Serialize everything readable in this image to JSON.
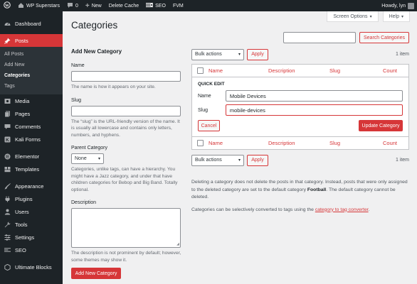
{
  "admin_bar": {
    "site_name": "WP Superstars",
    "comments_count": "0",
    "new_label": "New",
    "delete_cache_label": "Delete Cache",
    "seo_label": "SEO",
    "fvm_label": "FVM",
    "howdy": "Howdy, lyn"
  },
  "sidebar": {
    "items": [
      {
        "label": "Dashboard",
        "icon": "dashboard-icon"
      },
      {
        "label": "Posts",
        "icon": "pin-icon"
      },
      {
        "label": "Media",
        "icon": "media-icon"
      },
      {
        "label": "Pages",
        "icon": "pages-icon"
      },
      {
        "label": "Comments",
        "icon": "comments-icon"
      },
      {
        "label": "Kali Forms",
        "icon": "kali-forms-icon"
      },
      {
        "label": "Elementor",
        "icon": "elementor-icon"
      },
      {
        "label": "Templates",
        "icon": "templates-icon"
      },
      {
        "label": "Appearance",
        "icon": "brush-icon"
      },
      {
        "label": "Plugins",
        "icon": "plugins-icon"
      },
      {
        "label": "Users",
        "icon": "users-icon"
      },
      {
        "label": "Tools",
        "icon": "tools-icon"
      },
      {
        "label": "Settings",
        "icon": "settings-icon"
      },
      {
        "label": "SEO",
        "icon": "seo-icon"
      },
      {
        "label": "Ultimate Blocks",
        "icon": "ultimate-blocks-icon"
      }
    ],
    "posts_submenu": [
      "All Posts",
      "Add New",
      "Categories",
      "Tags"
    ]
  },
  "header": {
    "screen_options": "Screen Options",
    "help": "Help",
    "title": "Categories",
    "search_button": "Search Categories"
  },
  "add_form": {
    "heading": "Add New Category",
    "name_label": "Name",
    "name_desc": "The name is how it appears on your site.",
    "slug_label": "Slug",
    "slug_desc": "The “slug” is the URL-friendly version of the name. It is usually all lowercase and contains only letters, numbers, and hyphens.",
    "parent_label": "Parent Category",
    "parent_value": "None",
    "parent_desc": "Categories, unlike tags, can have a hierarchy. You might have a Jazz category, and under that have children categories for Bebop and Big Band. Totally optional.",
    "description_label": "Description",
    "description_desc": "The description is not prominent by default; however, some themes may show it.",
    "submit": "Add New Category"
  },
  "list": {
    "bulk_actions": "Bulk actions",
    "apply": "Apply",
    "item_count": "1 item",
    "columns": {
      "name": "Name",
      "description": "Description",
      "slug": "Slug",
      "count": "Count"
    },
    "quick_edit": {
      "title": "QUICK EDIT",
      "name_label": "Name",
      "name_value": "Mobile Devices",
      "slug_label": "Slug",
      "slug_value": "mobile-devices",
      "cancel": "Cancel",
      "update": "Update Category"
    }
  },
  "notes": {
    "delete_note_pre": "Deleting a category does not delete the posts in that category. Instead, posts that were only assigned to the deleted category are set to the default category ",
    "default_category": "Football",
    "delete_note_post": ". The default category cannot be deleted.",
    "convert_pre": "Categories can be selectively converted to tags using the ",
    "convert_link": "category to tag converter",
    "convert_post": "."
  }
}
